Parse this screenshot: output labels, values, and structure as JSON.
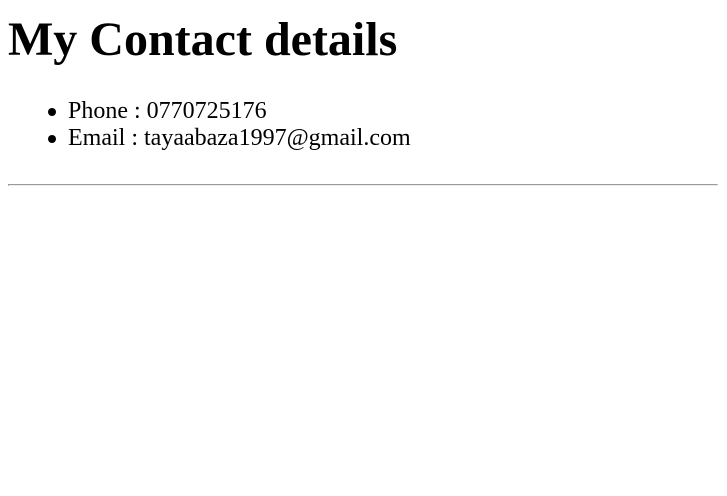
{
  "page": {
    "title": "My Contact details"
  },
  "contacts": [
    {
      "label": "Phone",
      "separator": " : ",
      "value": "0770725176"
    },
    {
      "label": "Email",
      "separator": " : ",
      "value": "tayaabaza1997@gmail.com"
    }
  ],
  "colors": {
    "text": "#000000",
    "background": "#ffffff",
    "divider": "#9a9a9a"
  }
}
